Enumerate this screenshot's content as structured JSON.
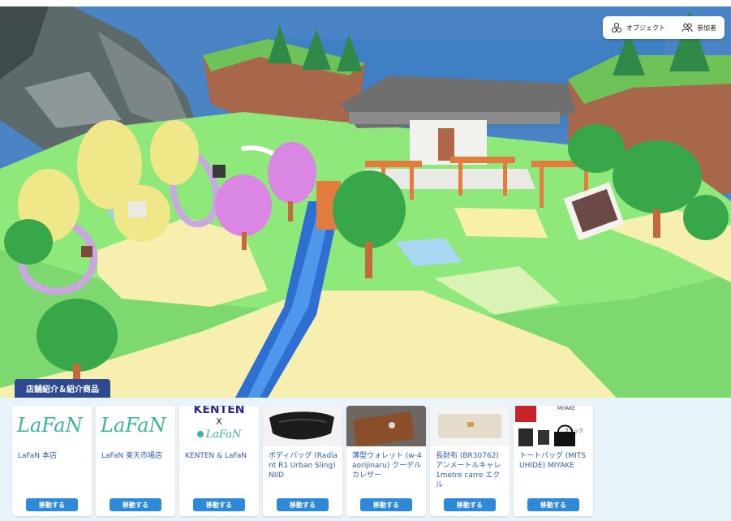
{
  "toolbar": {
    "objects_label": "オブジェクト",
    "participants_label": "参加者"
  },
  "section_tab": "店舗紹介＆紹介商品",
  "cards": [
    {
      "title": "LaFaN 本店",
      "button": "移動する",
      "thumb_text": "LaFaN"
    },
    {
      "title": "LaFaN 楽天市場店",
      "button": "移動する",
      "thumb_text": "LaFaN"
    },
    {
      "title": "KENTEN & LaFaN",
      "button": "移動する",
      "thumb_line1": "KENTEN",
      "thumb_line2": "X",
      "thumb_line3": "LaFaN"
    },
    {
      "title": "ボディバッグ (Radiant R1 Urban Sling) NIID",
      "button": "移動する"
    },
    {
      "title": "薄型ウォレット (w-4aorijinaru) クーデルカレザー",
      "button": "移動する"
    },
    {
      "title": "長財布 (BR30762) アンメートルキャレ 1metre carre エクル",
      "button": "移動する"
    },
    {
      "title": "トートバッグ (MITSUHIDE) MIYAKE",
      "button": "移動する",
      "thumb_brand": "MIYAKE",
      "thumb_note": "ブラック"
    }
  ],
  "colors": {
    "tab_bg": "#2d4a90",
    "button_bg": "#2e8ad8",
    "panel_bg": "#e8f3fa",
    "title_text": "#2d5db0"
  },
  "icons": [
    "objects-icon",
    "participants-icon"
  ]
}
